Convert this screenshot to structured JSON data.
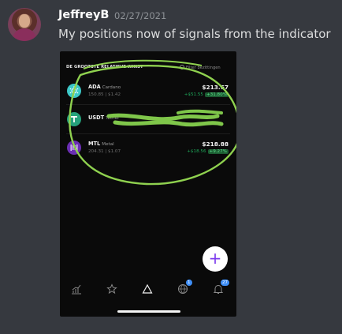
{
  "message": {
    "username": "JeffreyB",
    "timestamp": "02/27/2021",
    "text": "My positions now of signals from the indicator"
  },
  "embed": {
    "header_label": "DE GROOTSTE RELATIEVE WINST",
    "filter_placeholder": "Filter bezittingen",
    "positions": [
      {
        "symbol": "ADA",
        "name": "Cardano",
        "sub": "150.85 | $1.42",
        "value": "$213.67",
        "change": "+$51.55",
        "change_pct": "+31.80%",
        "color": "#3cc8c8",
        "icon": "cardano-icon"
      },
      {
        "symbol": "USDT",
        "name": "Tether",
        "sub": "",
        "value": "",
        "change": "",
        "change_pct": "",
        "color": "#26a17b",
        "icon": "tether-icon"
      },
      {
        "symbol": "MTL",
        "name": "Metal",
        "sub": "204.31 | $1.07",
        "value": "$218.88",
        "change": "+$18.56",
        "change_pct": "+9.27%",
        "color": "#6b2fb3",
        "icon": "metal-icon"
      }
    ],
    "fab_label": "+",
    "nav": [
      {
        "icon": "chart-icon"
      },
      {
        "icon": "star-icon"
      },
      {
        "icon": "triangle-icon"
      },
      {
        "icon": "globe-icon",
        "badge": "1"
      },
      {
        "icon": "bell-icon",
        "badge": "27"
      }
    ]
  }
}
